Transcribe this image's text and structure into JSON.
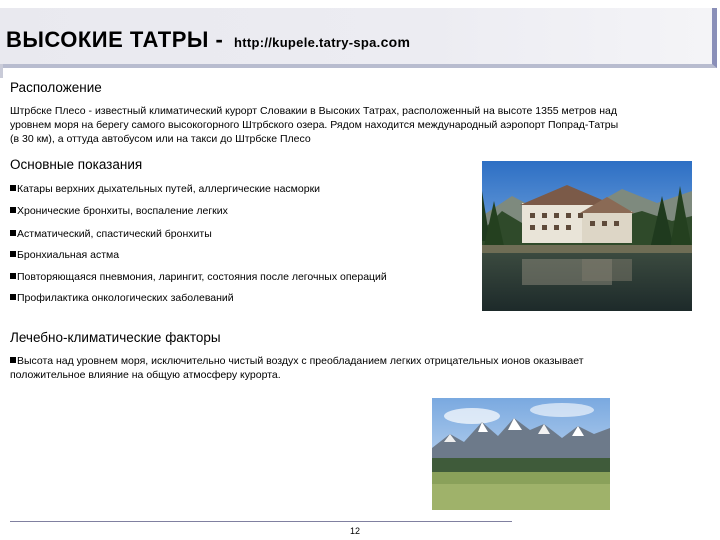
{
  "header": {
    "title": "ВЫСОКИЕ ТАТРЫ -",
    "url_main": "http://kupele.tatry-spa.",
    "url_tld": "com"
  },
  "location": {
    "heading": "Расположение",
    "line1": "Штрбске Плесо - известный климатический курорт Словакии в Высоких Татрах, расположенный на высоте 1355 метров над",
    "line2": "уровнем моря на берегу самого высокогорного Штрбского озера. Рядом находится международный аэропорт Попрад-Татры",
    "line3": "(в 30 км), а оттуда автобусом или на такси до Штрбске Плесо"
  },
  "indications": {
    "heading": "Основные показания",
    "items": [
      "Катары верхних дыхательных путей, аллергические насморки",
      "Хронические бронхиты, воспаление легких",
      "Астматический, спастический бронхиты",
      "Бронхиальная астма",
      "Повторяющаяся пневмония, ларингит, состояния после легочных операций",
      "Профилактика онкологических заболеваний"
    ]
  },
  "factors": {
    "heading": "Лечебно-климатические факторы",
    "line1": "Высота над уровнем моря, исключительно чистый воздух с преобладанием легких отрицательных ионов оказывает",
    "line2": "положительное влияние на общую атмосферу курорта."
  },
  "footer": {
    "page_number": "12"
  }
}
